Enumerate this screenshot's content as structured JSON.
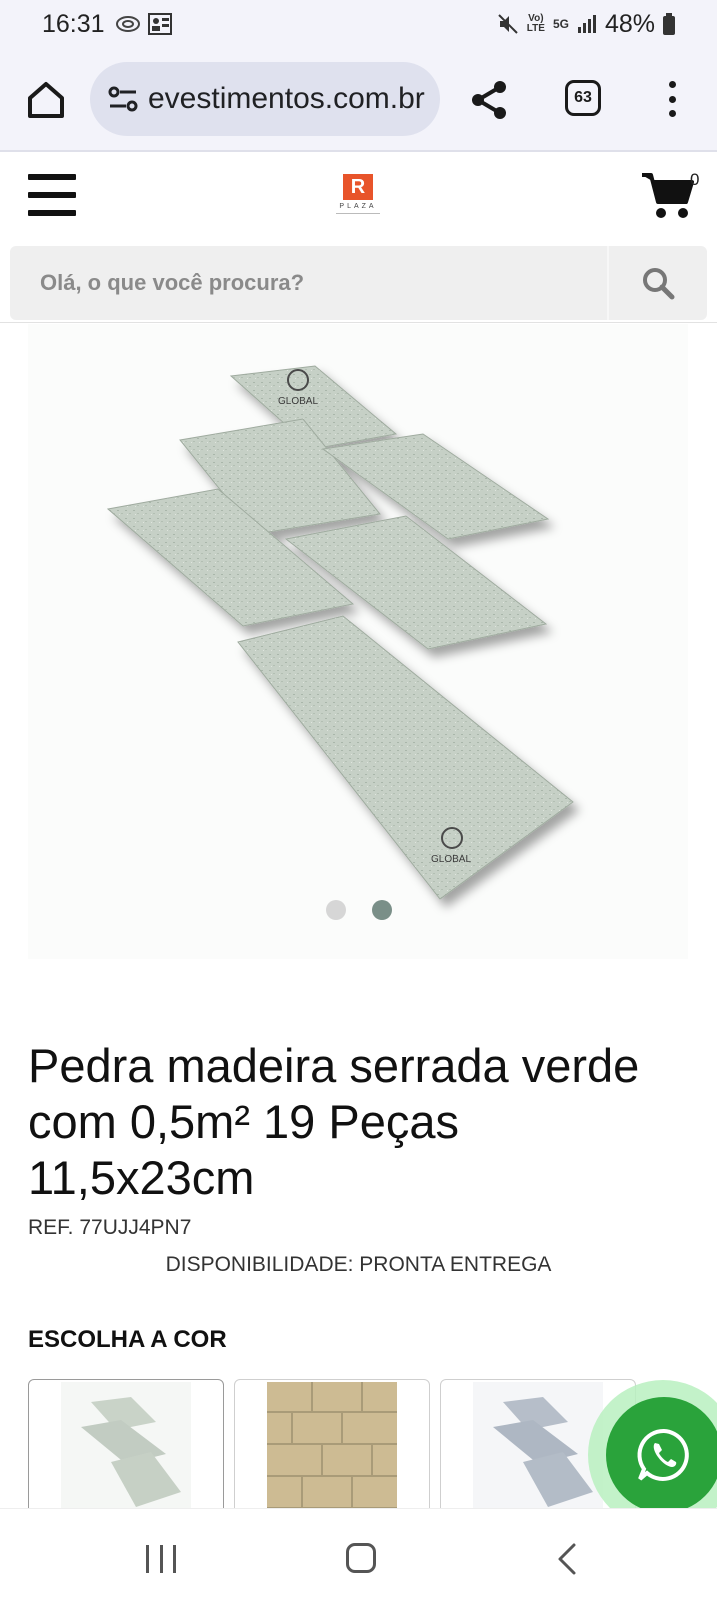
{
  "status_bar": {
    "time": "16:31",
    "network_top": "Vo)",
    "network_bottom": "LTE",
    "generation": "5G",
    "battery": "48%"
  },
  "browser": {
    "url": "evestimentos.com.br",
    "tab_count": "63"
  },
  "header": {
    "logo_text": "PLAZA",
    "cart_count": "0"
  },
  "search": {
    "placeholder": "Olá, o que você procura?"
  },
  "product": {
    "title": "Pedra madeira serrada verde com 0,5m² 19 Peças 11,5x23cm",
    "ref": "REF. 77UJJ4PN7",
    "availability": "DISPONIBILIDADE: PRONTA ENTREGA",
    "watermark": "GLOBAL",
    "image_count": 2,
    "active_image": 2
  },
  "color_picker": {
    "heading": "ESCOLHA A COR",
    "options": [
      "verde",
      "amarela",
      "cinza"
    ]
  },
  "colors": {
    "accent": "#e8542a",
    "whatsapp": "#2aa33b",
    "dot_active": "#7a8f88",
    "dot_inactive": "#d6d6d6"
  }
}
